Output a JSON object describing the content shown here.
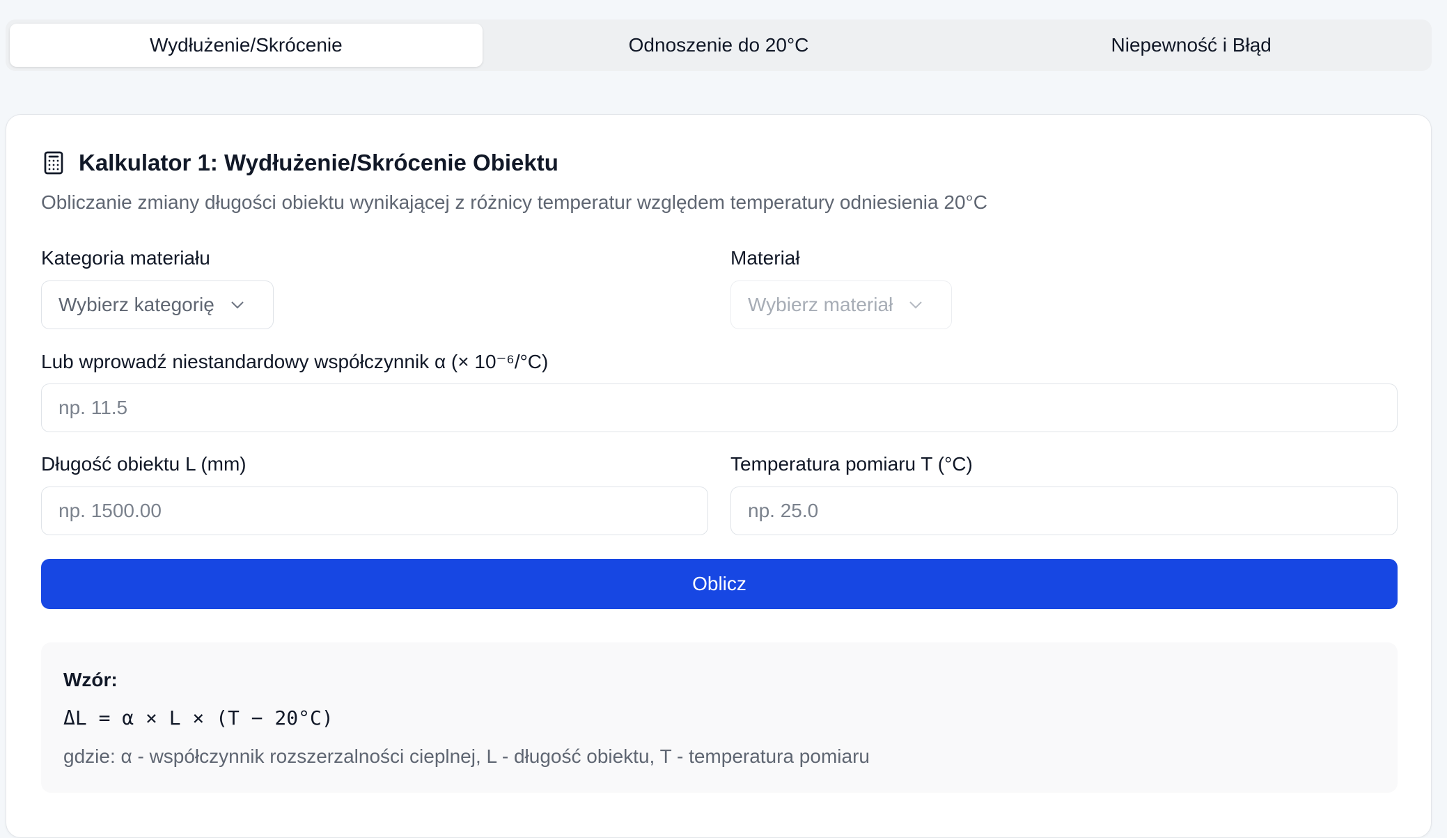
{
  "tabs": [
    {
      "label": "Wydłużenie/Skrócenie",
      "active": true
    },
    {
      "label": "Odnoszenie do 20°C",
      "active": false
    },
    {
      "label": "Niepewność i Błąd",
      "active": false
    }
  ],
  "card": {
    "icon": "calculator-icon",
    "title": "Kalkulator 1: Wydłużenie/Skrócenie Obiektu",
    "description": "Obliczanie zmiany długości obiektu wynikającej z różnicy temperatur względem temperatury odniesienia 20°C"
  },
  "form": {
    "category": {
      "label": "Kategoria materiału",
      "placeholder": "Wybierz kategorię"
    },
    "material": {
      "label": "Materiał",
      "placeholder": "Wybierz materiał"
    },
    "coefficient": {
      "label": "Lub wprowadź niestandardowy współczynnik α (× 10⁻⁶/°C)",
      "placeholder": "np. 11.5"
    },
    "length": {
      "label": "Długość obiektu L (mm)",
      "placeholder": "np. 1500.00"
    },
    "temperature": {
      "label": "Temperatura pomiaru T (°C)",
      "placeholder": "np. 25.0"
    },
    "submit_label": "Oblicz"
  },
  "formula": {
    "title": "Wzór:",
    "expression": "ΔL = α × L × (T − 20°C)",
    "note": "gdzie: α - współczynnik rozszerzalności cieplnej, L - długość obiektu, T - temperatura pomiaru"
  },
  "colors": {
    "accent": "#1747e3",
    "background": "#f4f7fa"
  }
}
